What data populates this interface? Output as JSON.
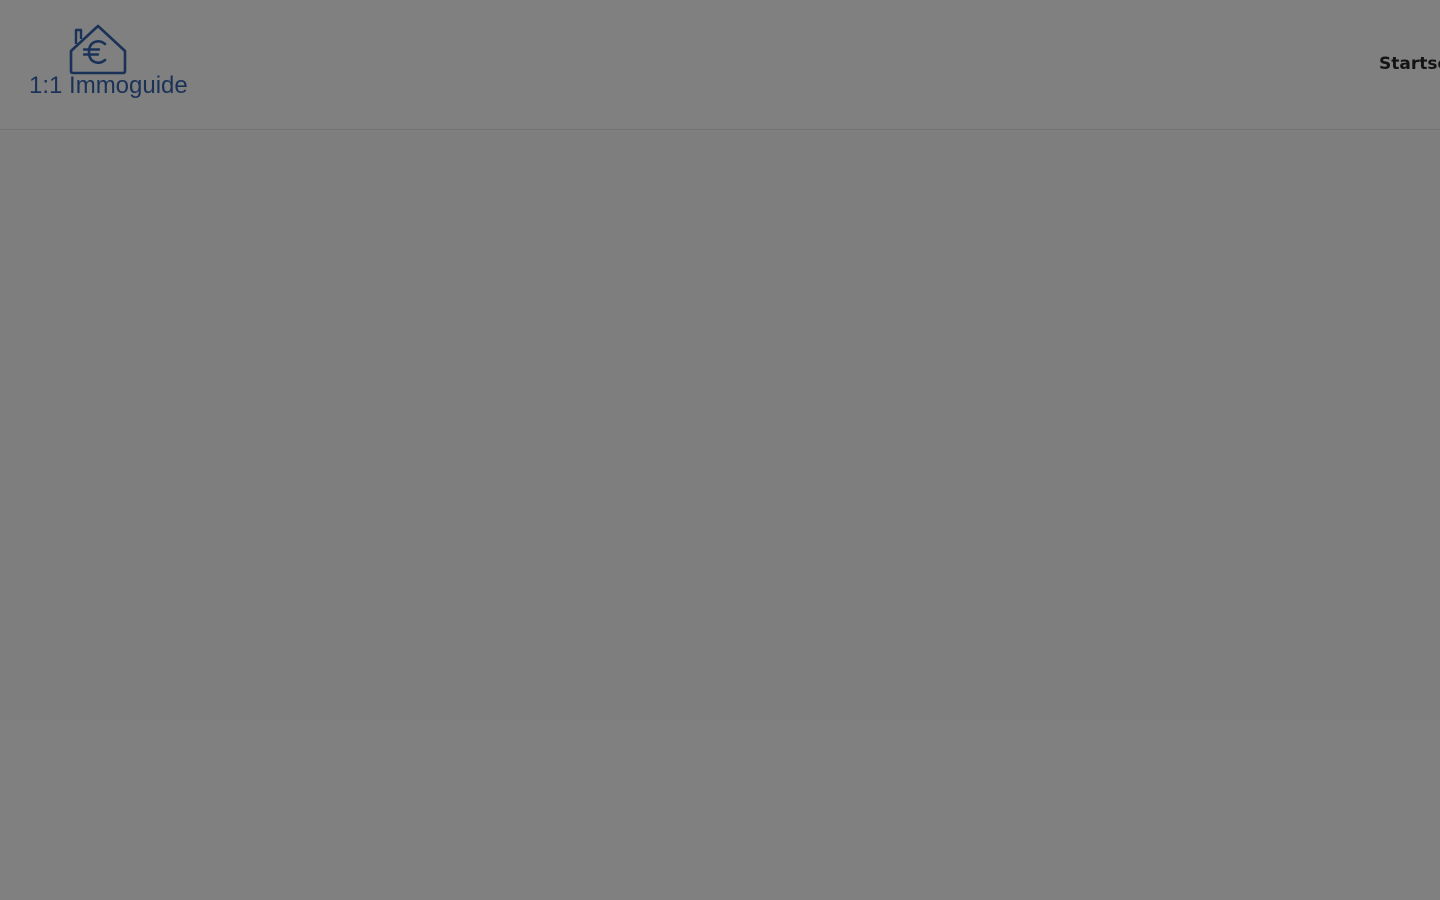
{
  "header": {
    "logo": {
      "icon": "house-euro-icon",
      "text": "1:1 Immoguide",
      "color": "#1a3257"
    },
    "nav": {
      "items": [
        {
          "label": "Startseite"
        }
      ]
    }
  },
  "colors": {
    "overlay": "#808080",
    "nav_text": "#141414"
  }
}
